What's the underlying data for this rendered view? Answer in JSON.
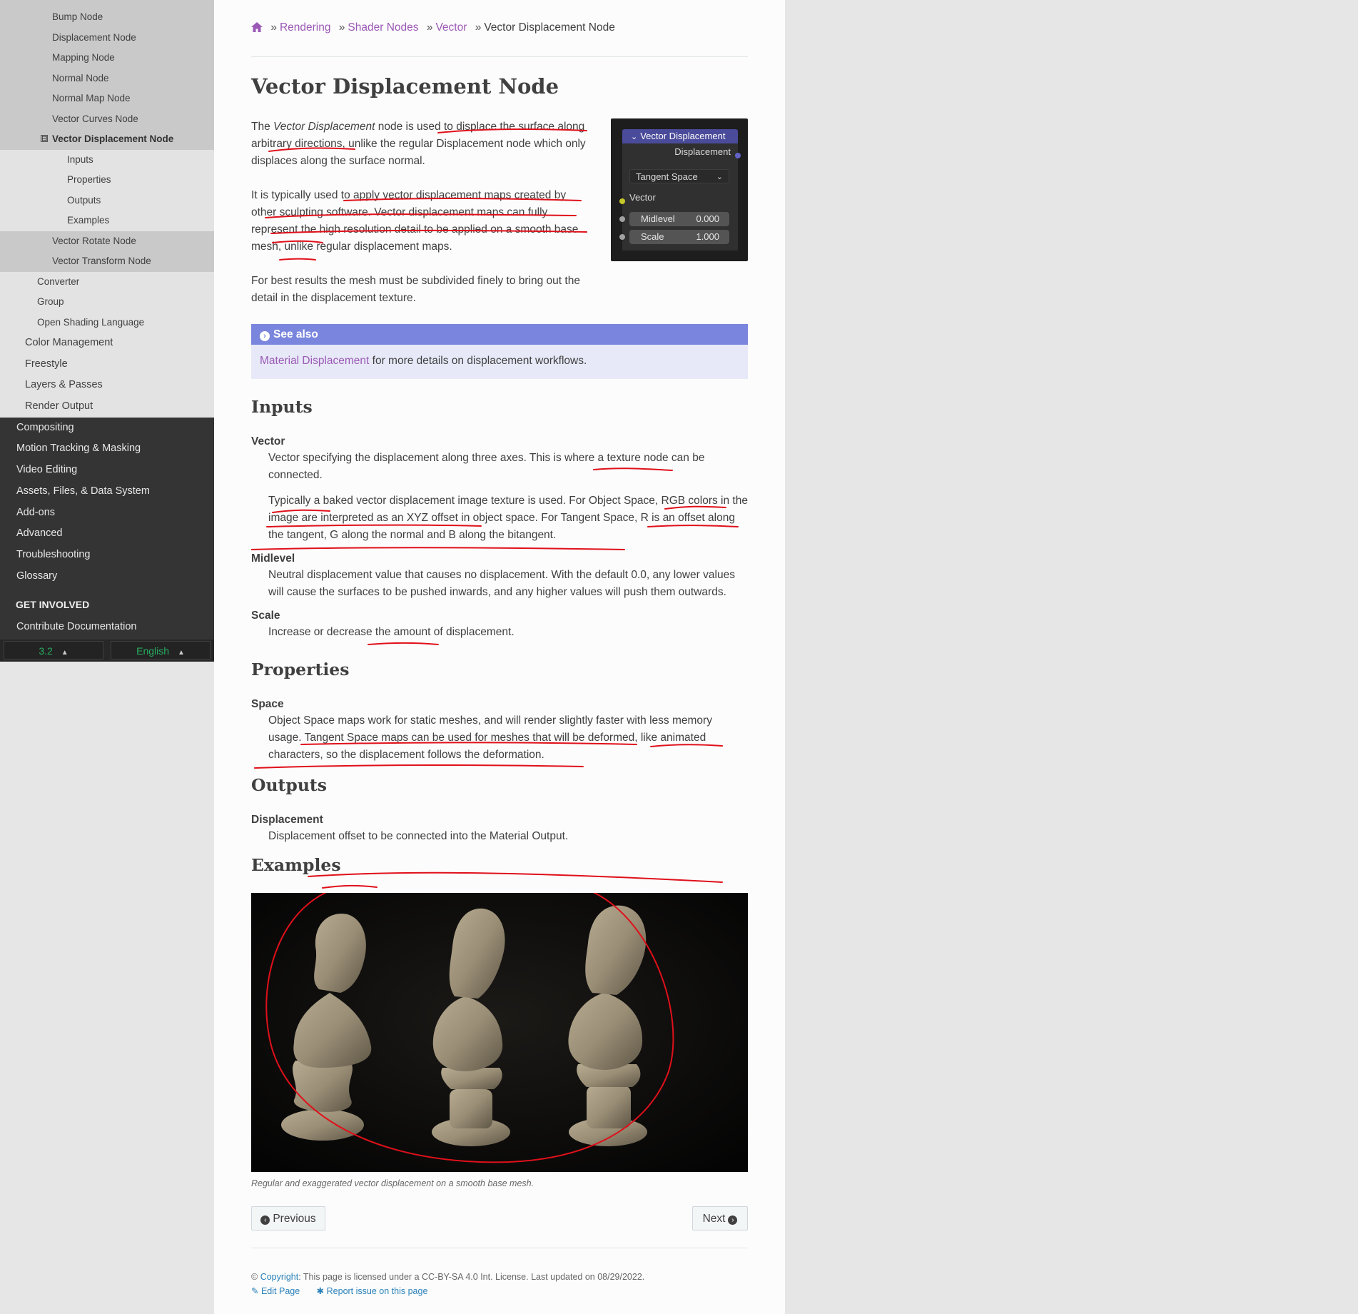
{
  "sidebar": {
    "items_gray_top": [
      "Bump Node",
      "Displacement Node",
      "Mapping Node",
      "Normal Node",
      "Normal Map Node",
      "Vector Curves Node"
    ],
    "current": "Vector Displacement Node",
    "current_toggle": "⊟",
    "sub": [
      "Inputs",
      "Properties",
      "Outputs",
      "Examples"
    ],
    "items_gray_bottom": [
      "Vector Rotate Node",
      "Vector Transform Node"
    ],
    "items_l2": [
      "Converter",
      "Group",
      "Open Shading Language"
    ],
    "items_l1": [
      "Color Management",
      "Freestyle",
      "Layers & Passes",
      "Render Output"
    ],
    "items_dark": [
      "Compositing",
      "Motion Tracking & Masking",
      "Video Editing",
      "Assets, Files, & Data System",
      "Add-ons",
      "Advanced",
      "Troubleshooting",
      "Glossary"
    ],
    "caption": "GET INVOLVED",
    "contribute": "Contribute Documentation",
    "version": "3.2",
    "language": "English"
  },
  "breadcrumb": {
    "home_icon": "home-icon",
    "items": [
      "Rendering",
      "Shader Nodes",
      "Vector"
    ],
    "current": "Vector Displacement Node"
  },
  "title": "Vector Displacement Node",
  "intro": {
    "p1_a": "The ",
    "p1_em": "Vector Displacement",
    "p1_b": " node is used to displace the surface along arbitrary directions, unlike the regular Displacement node which only displaces along the surface normal.",
    "p2": "It is typically used to apply vector displacement maps created by other sculpting software. Vector displacement maps can fully represent the high resolution detail to be applied on a smooth base mesh, unlike regular displacement maps.",
    "p3": "For best results the mesh must be subdivided finely to bring out the detail in the displacement texture."
  },
  "node": {
    "title": "Vector Displacement",
    "output": "Displacement",
    "space": "Tangent Space",
    "input_vector": "Vector",
    "midlevel_label": "Midlevel",
    "midlevel_value": "0.000",
    "scale_label": "Scale",
    "scale_value": "1.000",
    "header_color": "#4b4b9b",
    "vector_socket_color": "#c7c729",
    "output_socket_color": "#6363c7"
  },
  "seealso": {
    "title": "See also",
    "link": "Material Displacement",
    "text": " for more details on displacement workflows."
  },
  "inputs": {
    "heading": "Inputs",
    "vector_term": "Vector",
    "vector_def1": "Vector specifying the displacement along three axes. This is where a texture node can be connected.",
    "vector_def2": "Typically a baked vector displacement image texture is used. For Object Space, RGB colors in the image are interpreted as an XYZ offset in object space. For Tangent Space, R is an offset along the tangent, G along the normal and B along the bitangent.",
    "midlevel_term": "Midlevel",
    "midlevel_def": "Neutral displacement value that causes no displacement. With the default 0.0, any lower values will cause the surfaces to be pushed inwards, and any higher values will push them outwards.",
    "scale_term": "Scale",
    "scale_def": "Increase or decrease the amount of displacement."
  },
  "properties": {
    "heading": "Properties",
    "space_term": "Space",
    "space_def": "Object Space maps work for static meshes, and will render slightly faster with less memory usage. Tangent Space maps can be used for meshes that will be deformed, like animated characters, so the displacement follows the deformation."
  },
  "outputs": {
    "heading": "Outputs",
    "disp_term": "Displacement",
    "disp_def": "Displacement offset to be connected into the Material Output."
  },
  "examples": {
    "heading": "Examples",
    "caption": "Regular and exaggerated vector displacement on a smooth base mesh."
  },
  "nav": {
    "previous": "Previous",
    "next": "Next"
  },
  "footer": {
    "copyright_link": "Copyright",
    "text": ": This page is licensed under a CC-BY-SA 4.0 Int. License. Last updated on 08/29/2022.",
    "edit": "Edit Page",
    "report": "Report issue on this page"
  },
  "colors": {
    "link": "#9b59b6",
    "annotation": "#e0101a",
    "sidebar_dark": "#343434",
    "version_green": "#27ae60"
  }
}
